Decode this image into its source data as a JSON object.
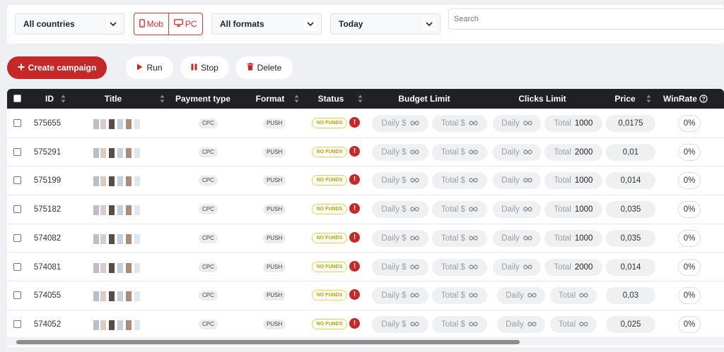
{
  "filters": {
    "country": "All countries",
    "device": {
      "mob": "Mob",
      "pc": "PC"
    },
    "format": "All formats",
    "period": "Today",
    "search_placeholder": "Search"
  },
  "actions": {
    "create": "Create campaign",
    "run": "Run",
    "stop": "Stop",
    "delete": "Delete"
  },
  "icons": {
    "create": "plus-icon",
    "run": "play-icon",
    "stop": "pause-icon",
    "delete": "trash-icon",
    "mob": "smartphone-icon",
    "pc": "monitor-icon",
    "dropdown": "chevron-down-icon",
    "sort": "sort-icon",
    "help": "help-circle-icon",
    "warning": "exclamation-icon"
  },
  "colors": {
    "accent": "#c62828",
    "header_bg": "#1f2125",
    "status_no_funds": "#b8a500"
  },
  "table": {
    "columns": {
      "id": "ID",
      "title": "Title",
      "payment": "Payment type",
      "format": "Format",
      "status": "Status",
      "budget": "Budget Limit",
      "clicks": "Clicks Limit",
      "price": "Price",
      "winrate": "WinRate"
    },
    "labels": {
      "daily": "Daily $",
      "total": "Total $",
      "daily_clicks": "Daily",
      "total_clicks": "Total",
      "infinity": "∞"
    },
    "rows": [
      {
        "id": "575655",
        "payment": "CPC",
        "format": "PUSH",
        "status": "NO FUNDS",
        "clicks_total": "1000",
        "price": "0,0175",
        "winrate": "0%"
      },
      {
        "id": "575291",
        "payment": "CPC",
        "format": "PUSH",
        "status": "NO FUNDS",
        "clicks_total": "2000",
        "price": "0,01",
        "winrate": "0%"
      },
      {
        "id": "575199",
        "payment": "CPC",
        "format": "PUSH",
        "status": "NO FUNDS",
        "clicks_total": "1000",
        "price": "0,014",
        "winrate": "0%"
      },
      {
        "id": "575182",
        "payment": "CPC",
        "format": "PUSH",
        "status": "NO FUNDS",
        "clicks_total": "1000",
        "price": "0,035",
        "winrate": "0%"
      },
      {
        "id": "574082",
        "payment": "CPC",
        "format": "PUSH",
        "status": "NO FUNDS",
        "clicks_total": "1000",
        "price": "0,035",
        "winrate": "0%"
      },
      {
        "id": "574081",
        "payment": "CPC",
        "format": "PUSH",
        "status": "NO FUNDS",
        "clicks_total": "2000",
        "price": "0,014",
        "winrate": "0%"
      },
      {
        "id": "574055",
        "payment": "CPC",
        "format": "PUSH",
        "status": "NO FUNDS",
        "clicks_total": "",
        "price": "0,03",
        "winrate": "0%"
      },
      {
        "id": "574052",
        "payment": "CPC",
        "format": "PUSH",
        "status": "NO FUNDS",
        "clicks_total": "",
        "price": "0,025",
        "winrate": "0%"
      }
    ]
  }
}
